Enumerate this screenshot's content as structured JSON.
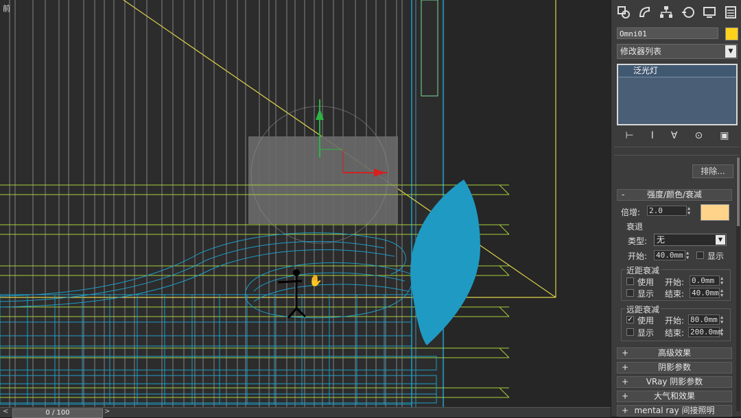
{
  "viewport": {
    "label": "前",
    "colors": {
      "bg": "#2c2c2c",
      "wire_blue": "#1e9ec8",
      "wire_green": "#a8d23a",
      "wire_white": "#c8c8c8",
      "yellow": "#e0d24a"
    }
  },
  "timeline": {
    "frame_text": "0 / 100",
    "left_arrow": "<",
    "right_arrow": ">"
  },
  "command_panel": {
    "tabs": [
      "create-tab",
      "modify-tab",
      "hierarchy-tab",
      "motion-tab",
      "display-tab",
      "utilities-tab"
    ],
    "object_name": "Omni01",
    "object_color": "#ffd21c",
    "modifier_list_label": "修改器列表",
    "stack_items": [
      "泛光灯"
    ],
    "stack_tools": [
      "⊢",
      "I",
      "∀",
      "⊙",
      "▣"
    ],
    "exclude_button": "排除...",
    "rollout_intensity": {
      "toggle": "-",
      "title": "强度/颜色/衰减",
      "multiplier_label": "倍增:",
      "multiplier_value": "2.0",
      "light_color": "#ffd38a",
      "decay_group": "衰退",
      "type_label": "类型:",
      "type_value": "无",
      "start_label": "开始:",
      "start_value": "40.0mm",
      "show_label": "显示",
      "near_group": "近距衰减",
      "near_use_label": "使用",
      "near_start_label": "开始:",
      "near_start_value": "0.0mm",
      "near_show_label": "显示",
      "near_end_label": "结束:",
      "near_end_value": "40.0mm",
      "far_group": "远距衰减",
      "far_use_label": "使用",
      "far_use_checked": true,
      "far_start_label": "开始:",
      "far_start_value": "80.0mm",
      "far_show_label": "显示",
      "far_end_label": "结束:",
      "far_end_value": "200.0mm"
    },
    "collapsed_rollouts": [
      {
        "toggle": "+",
        "title": "高级效果"
      },
      {
        "toggle": "+",
        "title": "阴影参数"
      },
      {
        "toggle": "+",
        "title": "VRay 阴影参数"
      },
      {
        "toggle": "+",
        "title": "大气和效果"
      },
      {
        "toggle": "+",
        "title": "mental ray 间接照明"
      }
    ]
  }
}
